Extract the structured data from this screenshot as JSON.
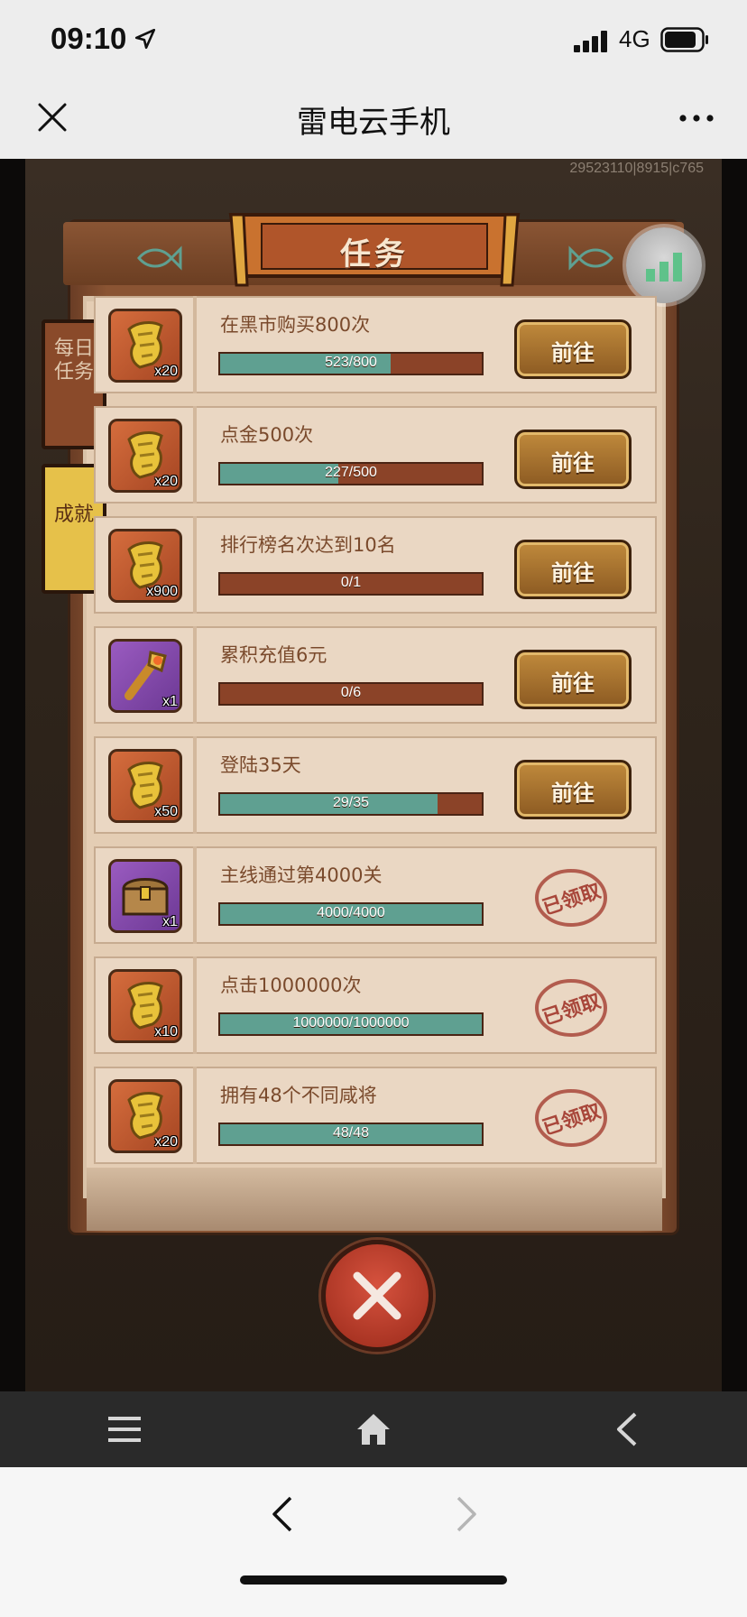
{
  "status_bar": {
    "time": "09:10",
    "network": "4G"
  },
  "header": {
    "title": "雷电云手机"
  },
  "game": {
    "id_text": "29523110|8915|c765",
    "panel_title": "任务",
    "side_tabs": [
      {
        "label": "每日任务",
        "active": false
      },
      {
        "label": "成就",
        "active": true
      }
    ],
    "go_label": "前往",
    "claimed_label": "已领取",
    "tasks": [
      {
        "name": "在黑市购买800次",
        "progress_text": "523/800",
        "progress": 0.654,
        "reward_icon": "gold-scroll-icon",
        "reward_qty": "x20",
        "reward_color": "gold",
        "state": "go"
      },
      {
        "name": "点金500次",
        "progress_text": "227/500",
        "progress": 0.454,
        "reward_icon": "gold-scroll-icon",
        "reward_qty": "x20",
        "reward_color": "gold",
        "state": "go"
      },
      {
        "name": "排行榜名次达到10名",
        "progress_text": "0/1",
        "progress": 0.0,
        "reward_icon": "gold-scroll-icon",
        "reward_qty": "x900",
        "reward_color": "gold",
        "state": "go"
      },
      {
        "name": "累积充值6元",
        "progress_text": "0/6",
        "progress": 0.0,
        "reward_icon": "golden-staff-icon",
        "reward_qty": "x1",
        "reward_color": "purple",
        "state": "go"
      },
      {
        "name": "登陆35天",
        "progress_text": "29/35",
        "progress": 0.829,
        "reward_icon": "gold-scroll-icon",
        "reward_qty": "x50",
        "reward_color": "gold",
        "state": "go"
      },
      {
        "name": "主线通过第4000关",
        "progress_text": "4000/4000",
        "progress": 1.0,
        "reward_icon": "treasure-chest-icon",
        "reward_qty": "x1",
        "reward_color": "purple",
        "state": "claimed"
      },
      {
        "name": "点击1000000次",
        "progress_text": "1000000/1000000",
        "progress": 1.0,
        "reward_icon": "gold-scroll-icon",
        "reward_qty": "x10",
        "reward_color": "gold",
        "state": "claimed"
      },
      {
        "name": "拥有48个不同咸将",
        "progress_text": "48/48",
        "progress": 1.0,
        "reward_icon": "gold-scroll-icon",
        "reward_qty": "x20",
        "reward_color": "gold",
        "state": "claimed"
      }
    ]
  },
  "colors": {
    "progress_fill": "#5fa091",
    "progress_track": "#8b4328",
    "stamp": "#a8463a"
  }
}
